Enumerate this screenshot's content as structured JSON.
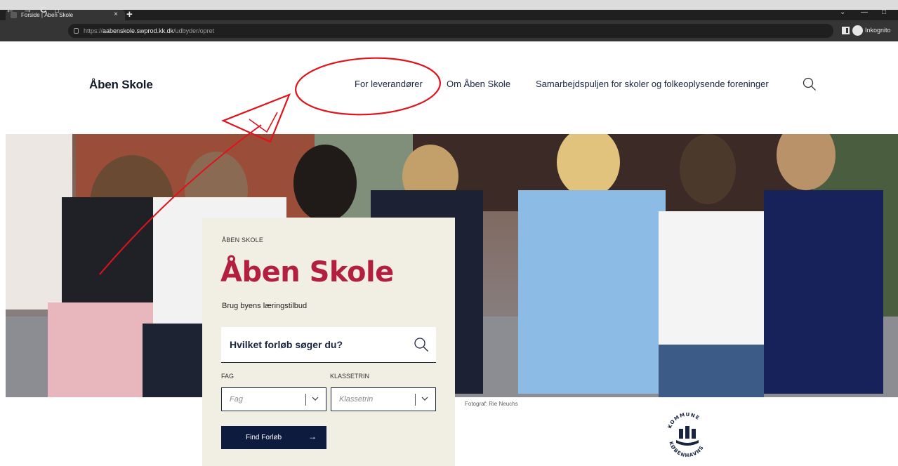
{
  "browser": {
    "tab_title": "Forside | Åben Skole",
    "tab_close": "×",
    "new_tab": "+",
    "url_scheme": "https://",
    "url_host": "aabenskole.swprod.kk.dk",
    "url_path": "/udbyder/opret",
    "incognito_label": "Inkognito",
    "nav": {
      "back": "←",
      "forward": "→",
      "reload": "C",
      "home": "⌂"
    },
    "window": {
      "chevron": "⌄",
      "minimize": "—",
      "restore": "□"
    }
  },
  "site": {
    "logo": "Åben Skole",
    "nav": [
      {
        "label": "For leverandører"
      },
      {
        "label": "Om Åben Skole"
      },
      {
        "label": "Samarbejdspuljen for skoler og folkeoplysende foreninger"
      }
    ]
  },
  "hero": {
    "eyebrow": "ÅBEN SKOLE",
    "title": "Åben Skole",
    "subtitle": "Brug byens læringstilbud",
    "search_prompt": "Hvilket forløb søger du?",
    "fag_label": "FAG",
    "fag_placeholder": "Fag",
    "klassetrin_label": "KLASSETRIN",
    "klassetrin_placeholder": "Klassetrin",
    "find_button": "Find Forløb",
    "find_arrow": "→",
    "photo_credit": "Fotograf: Rie Neuchs"
  },
  "footer": {
    "logo_top_text": "KOMMUNE",
    "logo_bottom_text": "KØBENHAVNS"
  },
  "colors": {
    "brand_red": "#b3203f",
    "navy": "#0d1b3e",
    "card_bg": "#f1eee4",
    "annotation_red": "#e0121b"
  }
}
